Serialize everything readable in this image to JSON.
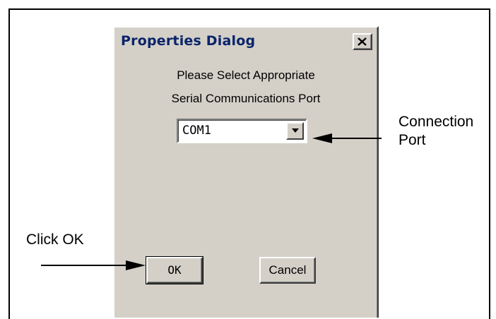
{
  "dialog": {
    "title": "Properties Dialog",
    "close_icon": "close-x-icon",
    "prompt_line1": "Please Select Appropriate",
    "prompt_line2": "Serial Communications Port",
    "combo": {
      "selected": "COM1",
      "arrow_icon": "chevron-down-icon"
    },
    "ok_label": "OK",
    "cancel_label": "Cancel"
  },
  "annotations": {
    "connection_line1": "Connection",
    "connection_line2": "Port",
    "click_ok": "Click OK"
  },
  "colors": {
    "dialog_bg": "#d4d0c8",
    "title_text": "#0a246a"
  }
}
